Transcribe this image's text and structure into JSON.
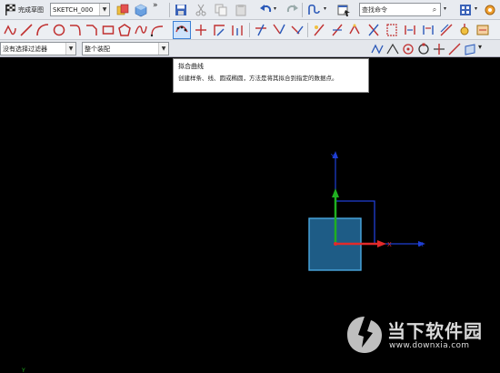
{
  "toolbar1": {
    "finish_sketch_label": "完成草图",
    "sketch_name": "SKETCH_000",
    "search_placeholder": "查找命令"
  },
  "toolbar3": {
    "filter_value": "没有选择过滤器",
    "scope_value": "整个装配"
  },
  "tooltip": {
    "title": "拟合曲线",
    "description": "创建样条、线、圆或椭圆，方法是将其拟合到指定的数据点。"
  },
  "axes": {
    "x_label": "X",
    "y_label": "Y",
    "corner_label": "Y"
  },
  "colors": {
    "x_axis": "#e32a2a",
    "y_axis": "#20b020",
    "csys_blue": "#1f3fd4",
    "datum_box": "#4aa8e0",
    "datum_fill": "#1e5c86"
  },
  "watermark": {
    "text": "当下软件园",
    "url": "www.downxia.com"
  }
}
